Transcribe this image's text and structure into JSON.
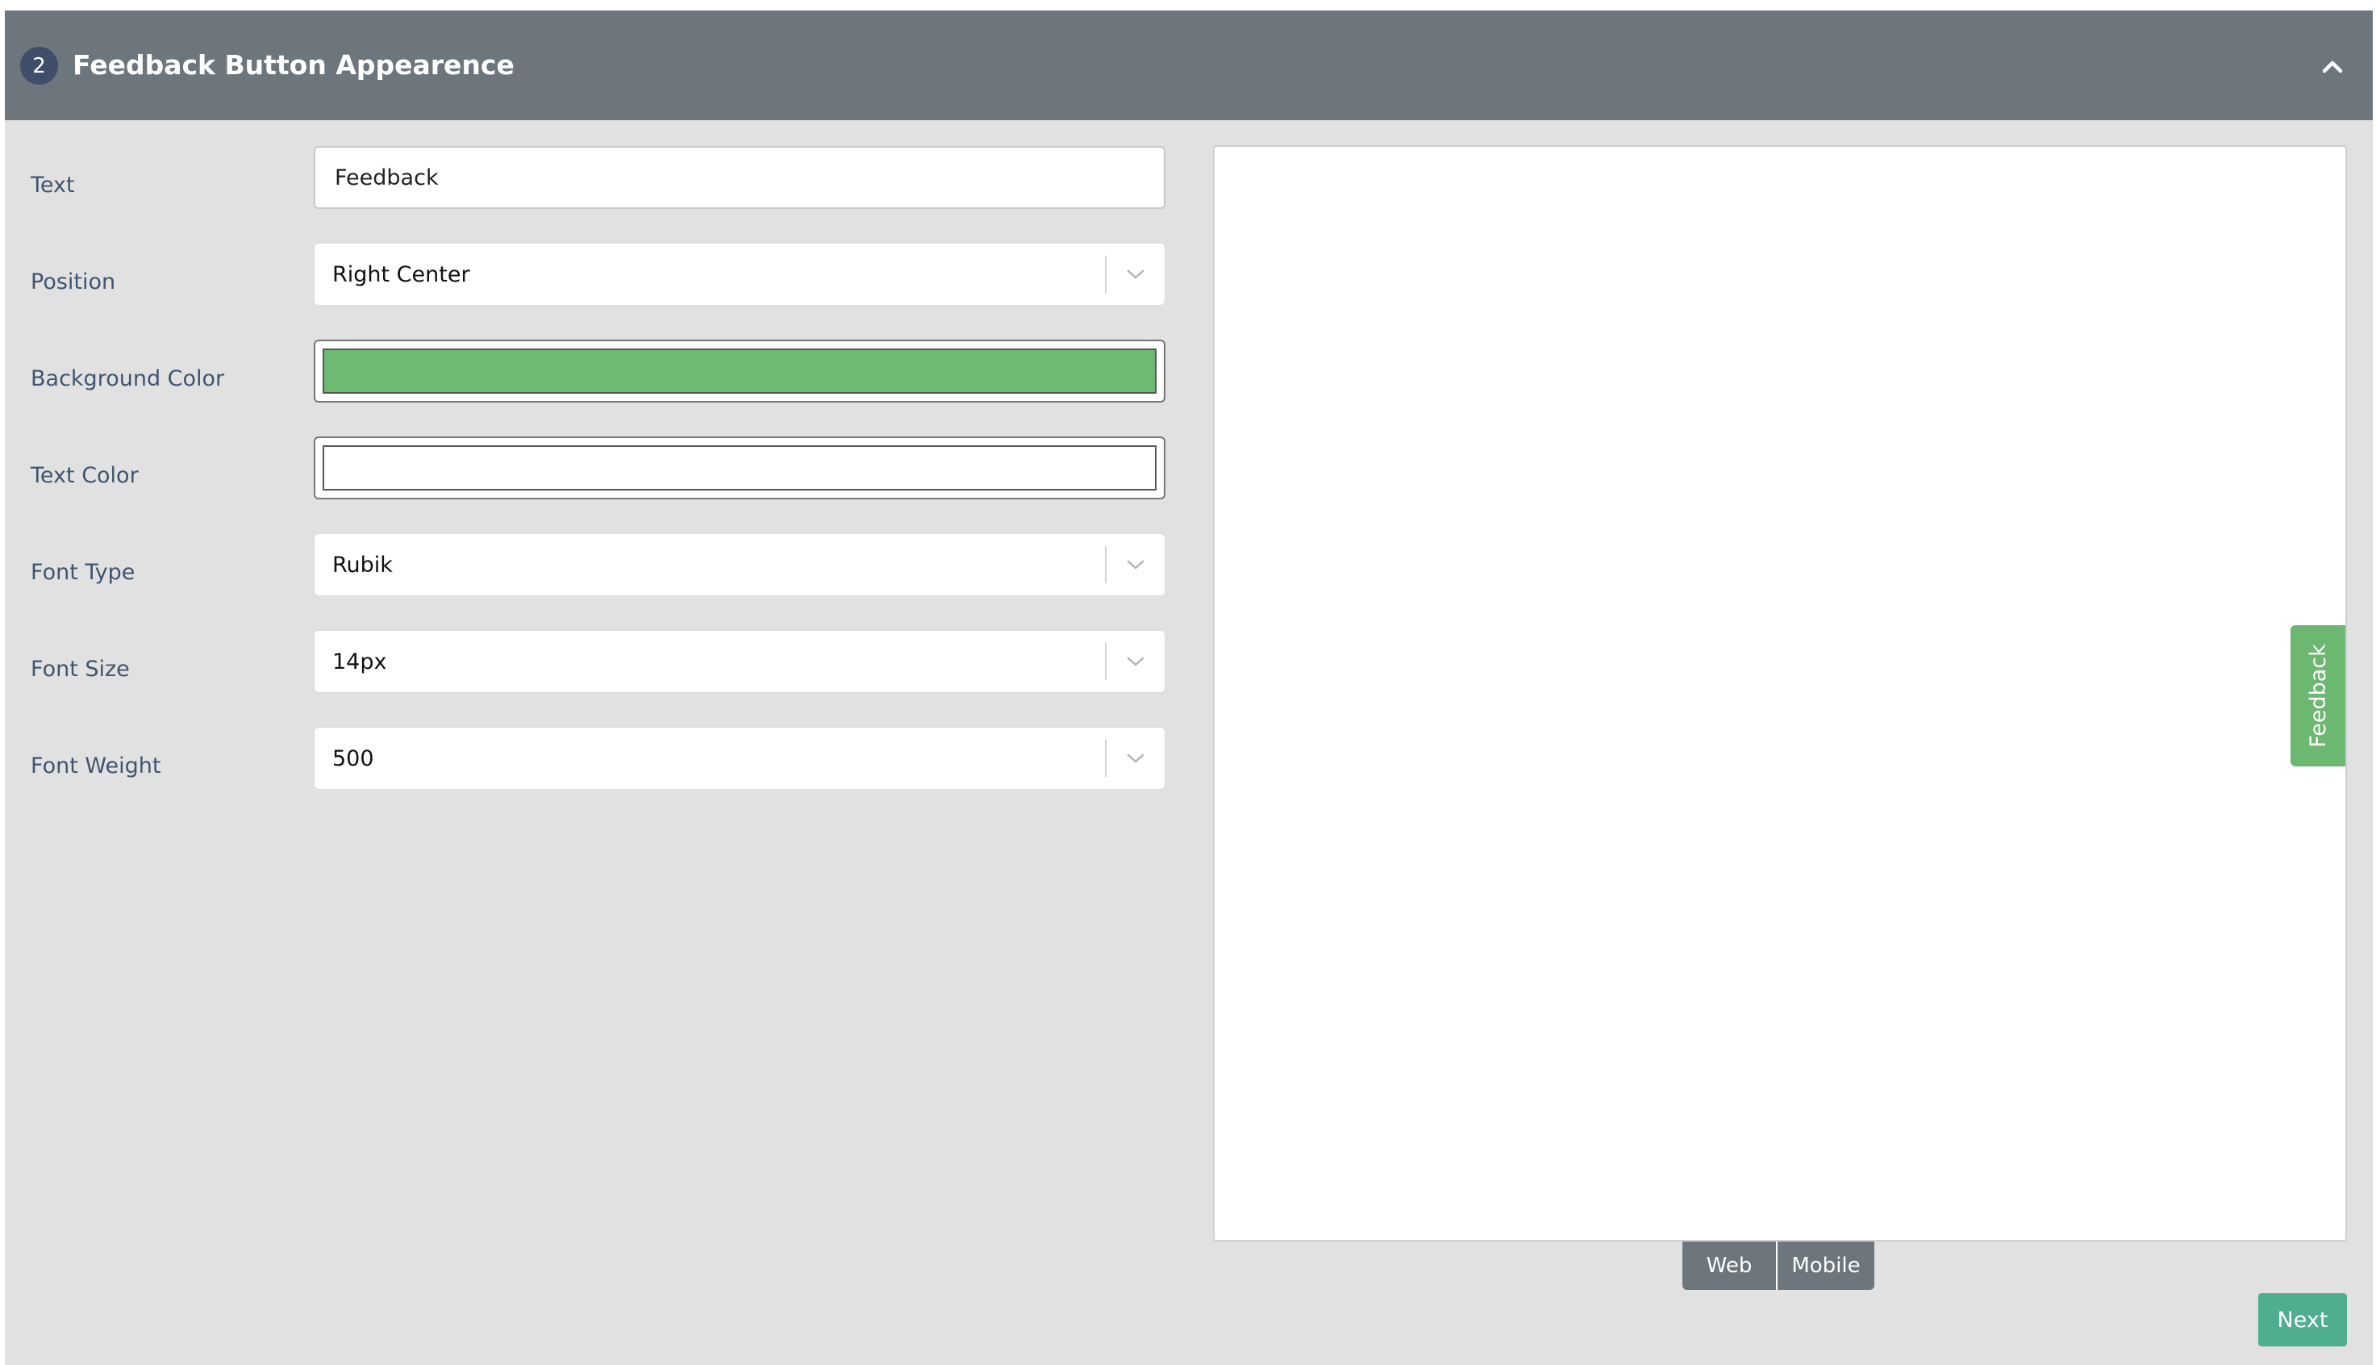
{
  "header": {
    "step_number": "2",
    "title": "Feedback Button Appearence",
    "collapse_icon": "chevron-up-icon"
  },
  "form": {
    "text": {
      "label": "Text",
      "value": "Feedback"
    },
    "position": {
      "label": "Position",
      "value": "Right Center"
    },
    "background_color": {
      "label": "Background Color",
      "value": "#6fba72"
    },
    "text_color": {
      "label": "Text Color",
      "value": "#ffffff"
    },
    "font_type": {
      "label": "Font Type",
      "value": "Rubik"
    },
    "font_size": {
      "label": "Font Size",
      "value": "14px"
    },
    "font_weight": {
      "label": "Font Weight",
      "value": "500"
    }
  },
  "preview": {
    "button_text": "Feedback",
    "button_color": "#6cb870",
    "modes": [
      "Web",
      "Mobile"
    ]
  },
  "actions": {
    "next_label": "Next",
    "next_color": "#4fae8f"
  },
  "colors": {
    "header_bg": "#6d757d",
    "panel_bg": "#e1e1e1",
    "badge_bg": "#3e4e6b",
    "label_text": "#3f5570"
  }
}
